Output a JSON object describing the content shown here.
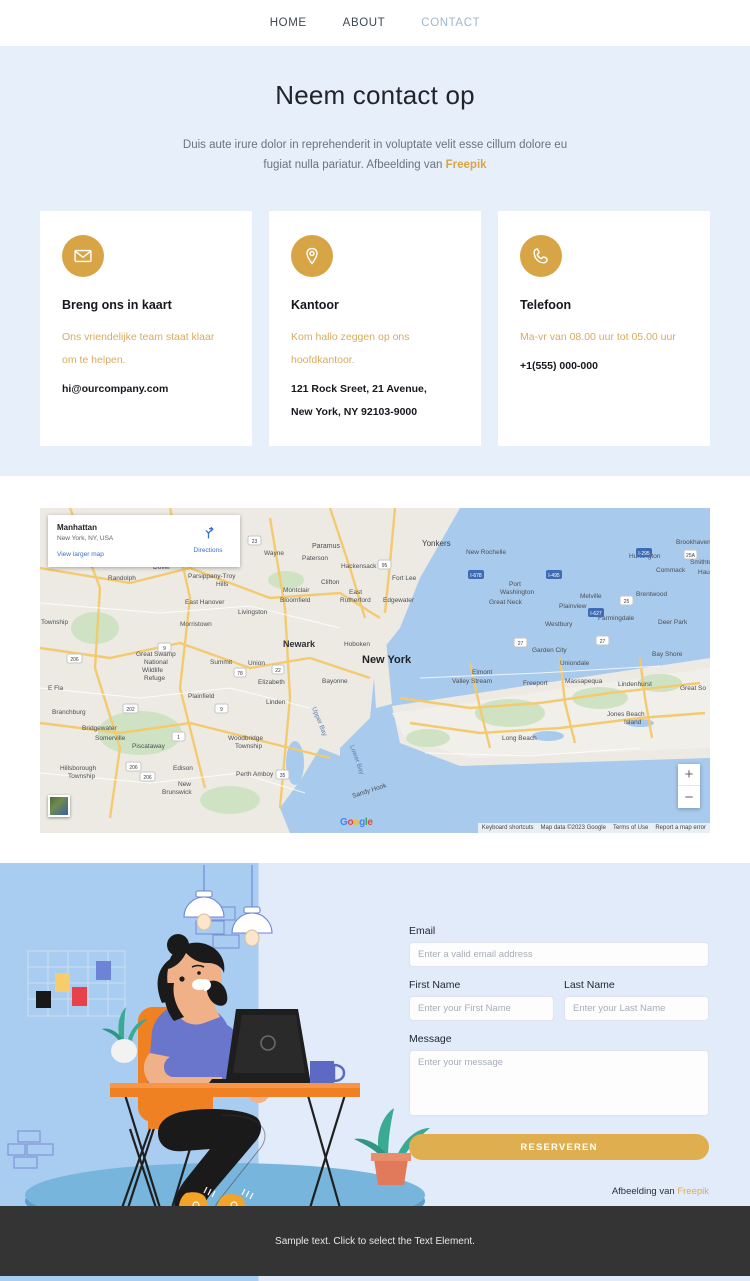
{
  "nav": {
    "items": [
      {
        "label": "HOME",
        "active": false
      },
      {
        "label": "ABOUT",
        "active": false
      },
      {
        "label": "CONTACT",
        "active": true
      }
    ]
  },
  "hero": {
    "title": "Neem contact op",
    "subtitle_line1": "Duis aute irure dolor in reprehenderit in voluptate velit esse cillum dolore eu",
    "subtitle_line2": "fugiat nulla pariatur. Afbeelding van ",
    "credit_link": "Freepik"
  },
  "cards": [
    {
      "icon": "envelope-icon",
      "title": "Breng ons in kaart",
      "description": "Ons vriendelijke team staat klaar om te helpen.",
      "detail_lines": [
        "hi@ourcompany.com"
      ]
    },
    {
      "icon": "map-pin-icon",
      "title": "Kantoor",
      "description": "Kom hallo zeggen op ons hoofdkantoor.",
      "detail_lines": [
        "121 Rock Sreet, 21 Avenue,",
        "New York, NY 92103-9000"
      ]
    },
    {
      "icon": "phone-icon",
      "title": "Telefoon",
      "description": "Ma-vr van 08.00 uur tot 05.00 uur",
      "detail_lines": [
        "+1(555) 000-000"
      ]
    }
  ],
  "map": {
    "info_title": "Manhattan",
    "info_subtitle": "New York, NY, USA",
    "view_larger": "View larger map",
    "directions_label": "Directions",
    "zoom_in": "+",
    "zoom_out": "−",
    "logo": "Google",
    "attribution": [
      "Keyboard shortcuts",
      "Map data ©2023 Google",
      "Terms of Use",
      "Report a map error"
    ],
    "labels": [
      "Paramus",
      "Yonkers",
      "New Rochelle",
      "Wayne",
      "Paterson",
      "Hackensack",
      "Huntington",
      "Smithto",
      "Commack",
      "Hauppau",
      "Dover",
      "Parsippany-Troy Hills",
      "Clifton",
      "Fort Lee",
      "East Rutherford",
      "Edgewater",
      "Port Washington",
      "Great Neck",
      "Melville",
      "Roxbury Township",
      "Randolph",
      "Montclair",
      "Bloomfield",
      "Plainview",
      "Brentwood",
      "East Hanover",
      "Livingston",
      "Morristown",
      "Westbury",
      "Farmingdale",
      "Deer Park",
      "Newark",
      "Hoboken",
      "Garden City",
      "Uniondale",
      "Bay Shore",
      "Great Swamp National Wildlife Refuge",
      "Summit",
      "Union",
      "New York",
      "Elmont",
      "Elizabeth",
      "Bayonne",
      "Valley Stream",
      "Freeport",
      "Massapequa",
      "Lindenhurst",
      "Great So",
      "Plainfield",
      "Linden",
      "Jones Beach Island",
      "Branchburg",
      "Bridgewater",
      "Somerville",
      "Piscataway",
      "Woodbridge Township",
      "Long Beach",
      "Hillsborough Township",
      "Edison",
      "New Brunswick",
      "Perth Amboy",
      "Sandy Hook",
      "Upper Bay",
      "Lower Bay",
      "Brookhaven"
    ]
  },
  "form": {
    "email_label": "Email",
    "email_placeholder": "Enter a valid email address",
    "email_value": "",
    "first_name_label": "First Name",
    "first_name_placeholder": "Enter your First Name",
    "first_name_value": "",
    "last_name_label": "Last Name",
    "last_name_placeholder": "Enter your Last Name",
    "last_name_value": "",
    "message_label": "Message",
    "message_placeholder": "Enter your message",
    "message_value": "",
    "submit_label": "RESERVEREN",
    "credit_prefix": "Afbeelding van ",
    "credit_link": "Freepik"
  },
  "footer": {
    "text": "Sample text. Click to select the Text Element."
  },
  "colors": {
    "accent_gold": "#d8a546",
    "hero_bg": "#e7effb",
    "illo_left_bg": "#a9cdf0",
    "illo_right_bg": "#e2ebfa",
    "footer_bg": "#343434",
    "nav_active": "#9db7cf"
  }
}
